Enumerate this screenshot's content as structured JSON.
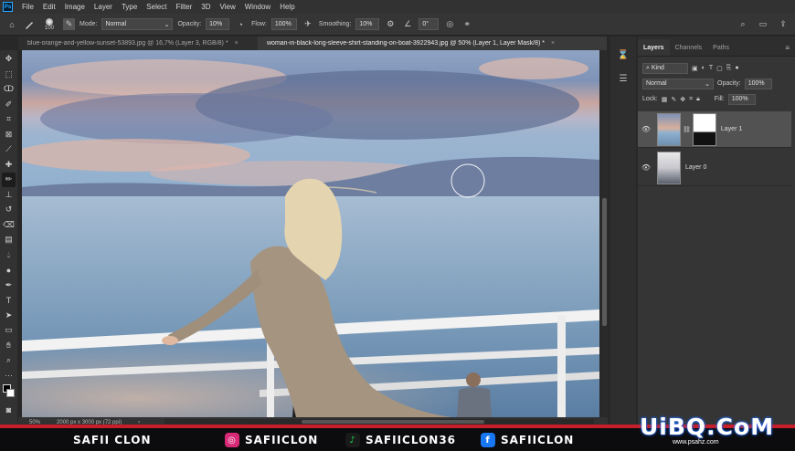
{
  "menubar": {
    "logo": "Ps",
    "items": [
      "File",
      "Edit",
      "Image",
      "Layer",
      "Type",
      "Select",
      "Filter",
      "3D",
      "View",
      "Window",
      "Help"
    ]
  },
  "options": {
    "brush_size": "100",
    "mode_label": "Mode:",
    "mode_value": "Normal",
    "opacity_label": "Opacity:",
    "opacity_value": "10%",
    "flow_label": "Flow:",
    "flow_value": "100%",
    "smoothing_label": "Smoothing:",
    "smoothing_value": "10%",
    "angle_value": "0°"
  },
  "tabs": [
    {
      "label": "blue-orange-and-yellow-sunset-53893.jpg @ 16,7% (Layer 3, RGB/8) *",
      "close": "×"
    },
    {
      "label": "woman-in-black-long-sleeve-shirt-standing-on-boat-3922943.jpg @ 50% (Layer 1, Layer Mask/8) *",
      "close": "×"
    }
  ],
  "status": {
    "zoom": "50%",
    "doc_info": "2000 px x 3000 px (72 ppi)"
  },
  "layers_panel": {
    "tabs": [
      "Layers",
      "Channels",
      "Paths"
    ],
    "kind_label": "Kind",
    "blend_mode": "Normal",
    "opacity_label": "Opacity:",
    "opacity_value": "100%",
    "lock_label": "Lock:",
    "fill_label": "Fill:",
    "fill_value": "100%",
    "layers": [
      {
        "name": "Layer 1",
        "selected": true,
        "has_mask": true
      },
      {
        "name": "Layer 0",
        "selected": false,
        "has_mask": false
      }
    ]
  },
  "banner": {
    "name": "SAFII CLON",
    "instagram": "SAFIICLON",
    "tiktok": "SAFIICLON36",
    "facebook": "SAFIICLON",
    "watermark": "UiBQ.CoM",
    "watermark_sub": "www.psahz.com",
    "colors": {
      "instagram": "#d62976",
      "tiktok": "#1fd24a",
      "facebook": "#1877f2",
      "accent": "#c81e2a"
    }
  }
}
